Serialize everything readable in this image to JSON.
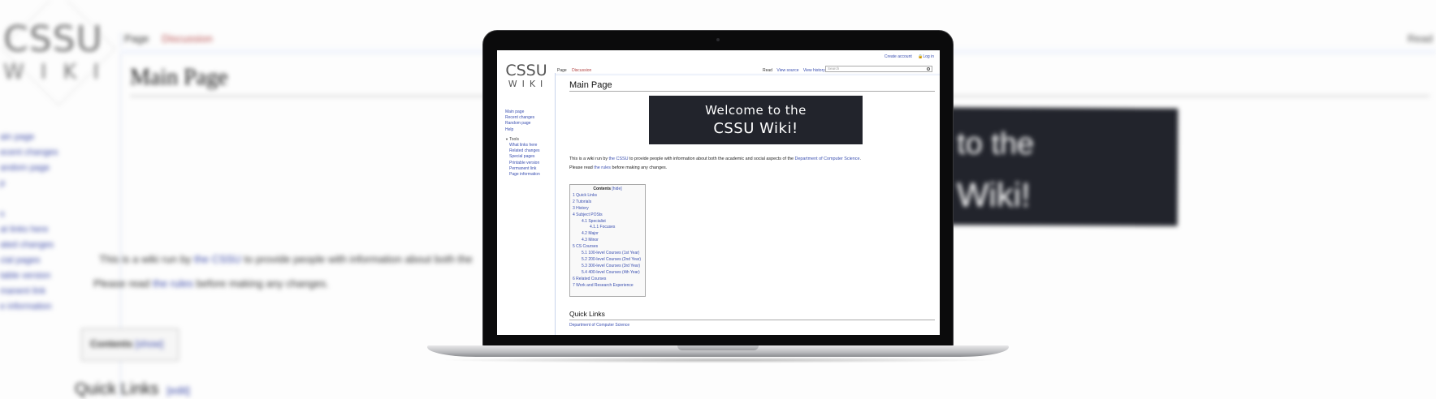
{
  "wiki": {
    "logo": {
      "line1": "CSSU",
      "line2": "WIKI"
    },
    "personal": {
      "create_account": "Create account",
      "login": "Log in"
    },
    "tabs": {
      "page": "Page",
      "discussion": "Discussion"
    },
    "views": {
      "read": "Read",
      "view_source": "View source",
      "view_history": "View history"
    },
    "search": {
      "placeholder": "Search"
    },
    "sidebar": {
      "items": [
        "Main page",
        "Recent changes",
        "Random page",
        "Help"
      ],
      "tools_label": "Tools",
      "tools": [
        "What links here",
        "Related changes",
        "Special pages",
        "Printable version",
        "Permanent link",
        "Page information"
      ]
    },
    "page_title": "Main Page",
    "banner": {
      "line1": "Welcome to the",
      "line2": "CSSU Wiki!"
    },
    "intro": {
      "t1": "This is a wiki run by ",
      "link1": "the CSSU",
      "t2": " to provide people with information about both the academic and social aspects of the ",
      "link2": "Department of Computer Science",
      "t3": "."
    },
    "rules": {
      "t1": "Please read ",
      "link": "the rules",
      "t2": " before making any changes."
    },
    "toc": {
      "title": "Contents",
      "toggle": "[hide]",
      "items": [
        {
          "text": "1 Quick Links",
          "level": 1
        },
        {
          "text": "2 Tutorials",
          "level": 1
        },
        {
          "text": "3 History",
          "level": 1
        },
        {
          "text": "4 Subject POSts",
          "level": 1
        },
        {
          "text": "4.1 Specialist",
          "level": 2
        },
        {
          "text": "4.1.1 Focuses",
          "level": 3
        },
        {
          "text": "4.2 Major",
          "level": 2
        },
        {
          "text": "4.3 Minor",
          "level": 2
        },
        {
          "text": "5 CS Courses",
          "level": 1
        },
        {
          "text": "5.1 100-level Courses (1st Year)",
          "level": 2
        },
        {
          "text": "5.2 200-level Courses (2nd Year)",
          "level": 2
        },
        {
          "text": "5.3 300-level Courses (3rd Year)",
          "level": 2
        },
        {
          "text": "5.4 400-level Courses (4th Year)",
          "level": 2
        },
        {
          "text": "6 Related Courses",
          "level": 1
        },
        {
          "text": "7 Work and Research Experience",
          "level": 1
        }
      ]
    },
    "quick_links_heading": "Quick Links",
    "dept_link": "Department of Computer Science"
  },
  "background": {
    "logo": {
      "line1": "CSSU",
      "line2": "WIKI"
    },
    "tabs": {
      "page": "Page",
      "discussion": "Discussion"
    },
    "read": "Read",
    "title": "Main Page",
    "side_items": [
      "ain page",
      "ecent changes",
      "andom page",
      "p",
      "",
      "s",
      "at links here",
      "ated changes",
      "cial pages",
      "table version",
      "manent link",
      "e information"
    ],
    "banner": {
      "line1": "to the",
      "line2": "Wiki!"
    },
    "intro": {
      "t1": "This is a wiki run by ",
      "link": "the CSSU",
      "t2": " to provide people with information about both the"
    },
    "rules": {
      "t1": "Please read ",
      "link": "the rules",
      "t2": " before making any changes."
    },
    "contents": {
      "title": "Contents",
      "toggle": "[show]"
    },
    "quick": {
      "title": "Quick Links",
      "edit": "[edit]"
    }
  }
}
